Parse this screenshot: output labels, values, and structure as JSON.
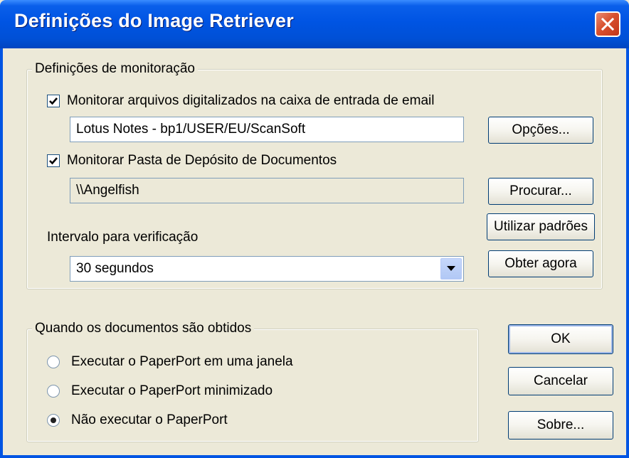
{
  "window": {
    "title": "Definições do Image Retriever"
  },
  "monitoring": {
    "legend": "Definições de monitoração",
    "email_checkbox": {
      "label": "Monitorar arquivos digitalizados na caixa de entrada de email",
      "checked": true
    },
    "email_source_value": "Lotus Notes - bp1/USER/EU/ScanSoft",
    "options_button": "Opções...",
    "folder_checkbox": {
      "label": "Monitorar Pasta de Depósito de Documentos",
      "checked": true
    },
    "folder_path_value": "\\\\Angelfish",
    "browse_button": "Procurar...",
    "defaults_button": "Utilizar padrões",
    "interval_label": "Intervalo para verificação",
    "interval_value": "30 segundos",
    "fetch_now_button": "Obter agora"
  },
  "when_obtained": {
    "legend": "Quando os documentos são obtidos",
    "options": [
      {
        "label": "Executar o PaperPort em uma janela",
        "selected": false
      },
      {
        "label": "Executar o PaperPort minimizado",
        "selected": false
      },
      {
        "label": "Não executar o PaperPort",
        "selected": true
      }
    ]
  },
  "buttons": {
    "ok": "OK",
    "cancel": "Cancelar",
    "about": "Sobre..."
  },
  "colors": {
    "titlebar": "#0054E3",
    "dialog_bg": "#ECE9D8",
    "close": "#D8512F"
  }
}
